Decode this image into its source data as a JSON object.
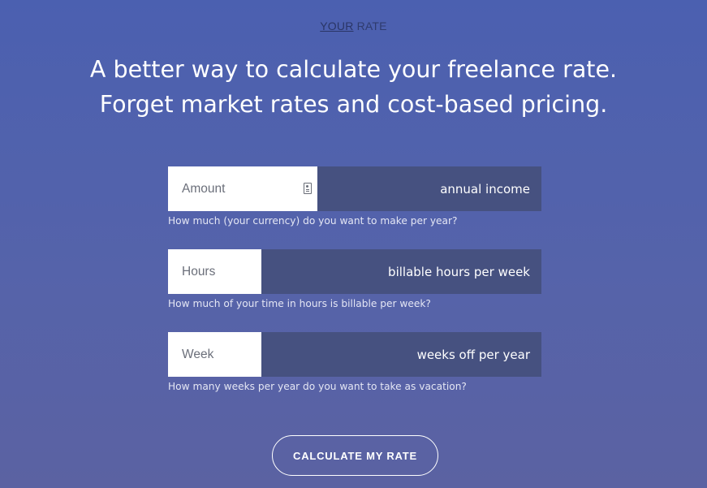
{
  "brand": {
    "your": "YOUR",
    "rate": "RATE"
  },
  "headline": {
    "line1": "A better way to calculate your freelance rate.",
    "line2": "Forget market rates and cost-based pricing."
  },
  "form": {
    "fields": [
      {
        "placeholder": "Amount",
        "value": "",
        "label": "annual income",
        "help": "How much (your currency) do you want to make per year?",
        "has_autofill_icon": true,
        "autofill_icon": "contact-card-icon"
      },
      {
        "placeholder": "Hours",
        "value": "",
        "label": "billable hours per week",
        "help": "How much of your time in hours is billable per week?"
      },
      {
        "placeholder": "Week",
        "value": "",
        "label": "weeks off per year",
        "help": "How many weeks per year do you want to take as vacation?"
      }
    ]
  },
  "actions": {
    "calculate_label": "CALCULATE MY RATE"
  },
  "colors": {
    "background_top": "#4b60b0",
    "background_bottom": "#5b62a2",
    "field_label_bg": "#465180",
    "input_bg": "#ffffff",
    "brand_text": "#2f3b6e"
  }
}
